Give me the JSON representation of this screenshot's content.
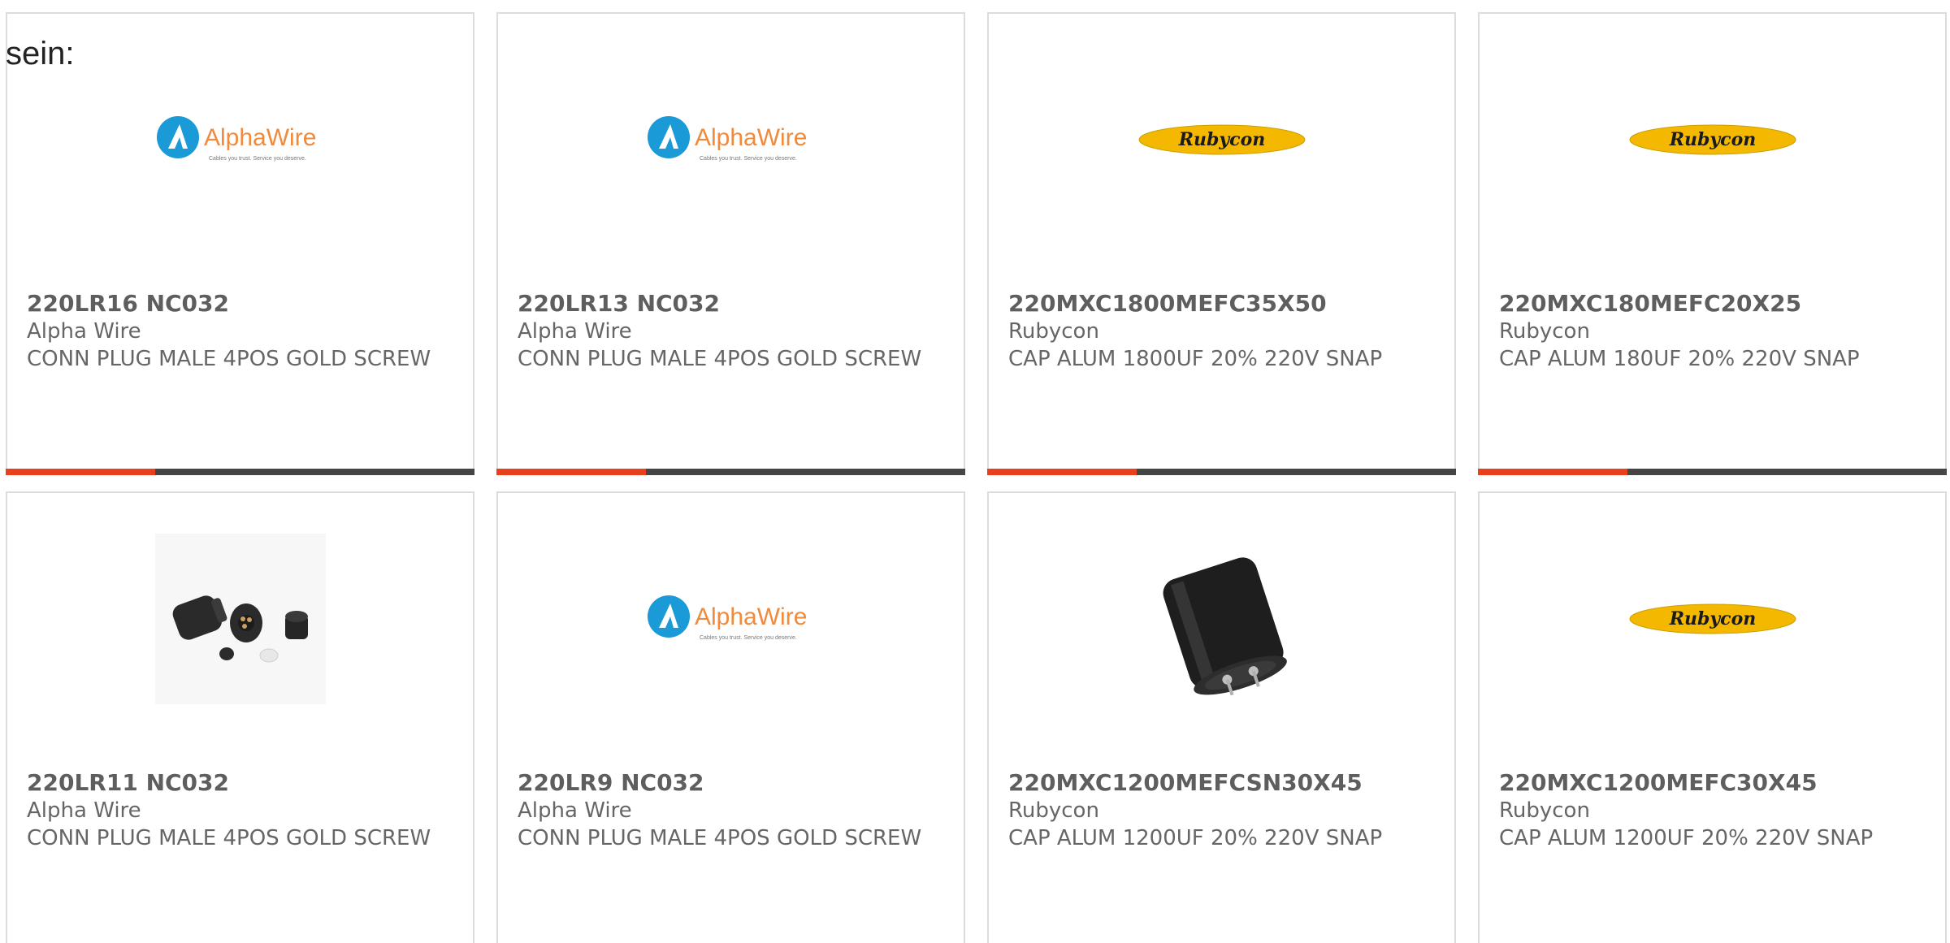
{
  "top_fragment": "sein:",
  "colors": {
    "accent_bar": "#e8401c",
    "dark_bar": "#454545",
    "card_border": "#dcdcdc",
    "text": "#666666"
  },
  "products": [
    {
      "part": "220LR16 NC032",
      "maker": "Alpha Wire",
      "desc": "CONN PLUG MALE 4POS GOLD SCREW",
      "image": "alphawire-logo"
    },
    {
      "part": "220LR13 NC032",
      "maker": "Alpha Wire",
      "desc": "CONN PLUG MALE 4POS GOLD SCREW",
      "image": "alphawire-logo"
    },
    {
      "part": "220MXC1800MEFC35X50",
      "maker": "Rubycon",
      "desc": "CAP ALUM 1800UF 20% 220V SNAP",
      "image": "rubycon-logo"
    },
    {
      "part": "220MXC180MEFC20X25",
      "maker": "Rubycon",
      "desc": "CAP ALUM 180UF 20% 220V SNAP",
      "image": "rubycon-logo"
    },
    {
      "part": "220LR11 NC032",
      "maker": "Alpha Wire",
      "desc": "CONN PLUG MALE 4POS GOLD SCREW",
      "image": "connector-photo"
    },
    {
      "part": "220LR9 NC032",
      "maker": "Alpha Wire",
      "desc": "CONN PLUG MALE 4POS GOLD SCREW",
      "image": "alphawire-logo"
    },
    {
      "part": "220MXC1200MEFCSN30X45",
      "maker": "Rubycon",
      "desc": "CAP ALUM 1200UF 20% 220V SNAP",
      "image": "capacitor-photo"
    },
    {
      "part": "220MXC1200MEFC30X45",
      "maker": "Rubycon",
      "desc": "CAP ALUM 1200UF 20% 220V SNAP",
      "image": "rubycon-logo"
    }
  ],
  "logos": {
    "alphawire_text": "AlphaWire",
    "alphawire_tagline": "Cables you trust. Service you deserve.",
    "rubycon_text": "Rubycon"
  }
}
